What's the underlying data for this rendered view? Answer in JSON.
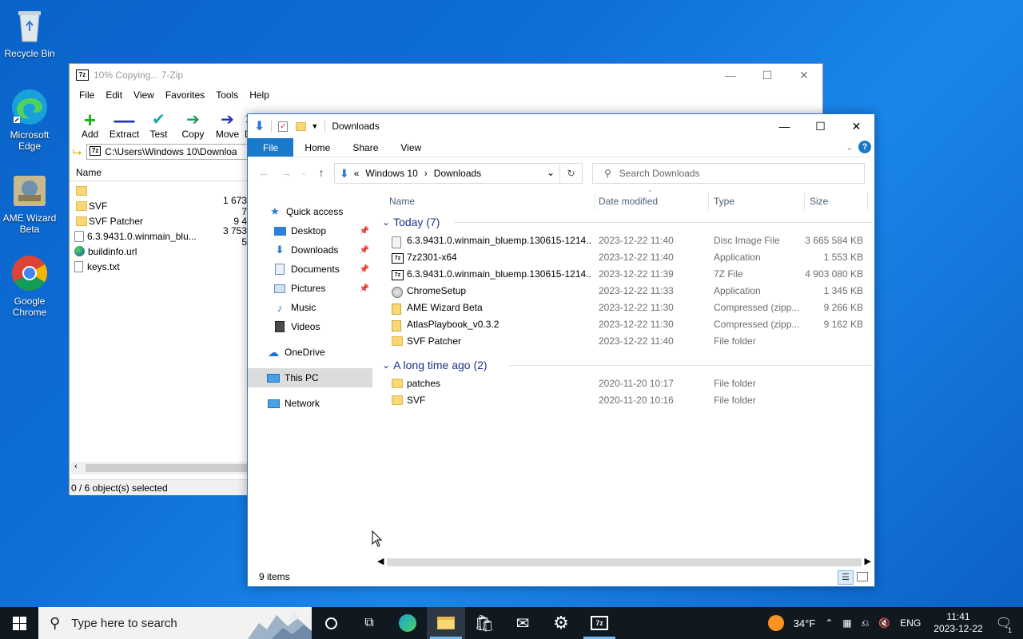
{
  "desktop": {
    "icons": [
      {
        "label": "Recycle Bin"
      },
      {
        "label": "Microsoft Edge"
      },
      {
        "label": "AME Wizard Beta"
      },
      {
        "label": "Google Chrome"
      }
    ]
  },
  "zip": {
    "title": "10% Copying... 7-Zip",
    "menu": [
      "File",
      "Edit",
      "View",
      "Favorites",
      "Tools",
      "Help"
    ],
    "tools": [
      "Add",
      "Extract",
      "Test",
      "Copy",
      "Move",
      "D"
    ],
    "path": "C:\\Users\\Windows 10\\Downloa",
    "col_name": "Name",
    "rows": [
      {
        "name": "",
        "size": ""
      },
      {
        "name": "SVF",
        "size": "1 673 7"
      },
      {
        "name": "SVF Patcher",
        "size": "9 4"
      },
      {
        "name": "6.3.9431.0.winmain_blu...",
        "size": "3 753 5"
      },
      {
        "name": "buildinfo.url",
        "size": ""
      },
      {
        "name": "keys.txt",
        "size": ""
      }
    ],
    "status": "0 / 6 object(s) selected"
  },
  "explorer": {
    "title": "Downloads",
    "ribbon_tabs": [
      "File",
      "Home",
      "Share",
      "View"
    ],
    "breadcrumb": {
      "prefix": "«",
      "parent": "Windows 10",
      "current": "Downloads"
    },
    "search_placeholder": "Search Downloads",
    "nav": {
      "quick_access": "Quick access",
      "desktop": "Desktop",
      "downloads": "Downloads",
      "documents": "Documents",
      "pictures": "Pictures",
      "music": "Music",
      "videos": "Videos",
      "onedrive": "OneDrive",
      "this_pc": "This PC",
      "network": "Network"
    },
    "columns": {
      "name": "Name",
      "date": "Date modified",
      "type": "Type",
      "size": "Size"
    },
    "groups": [
      {
        "label": "Today (7)",
        "files": [
          {
            "name": "6.3.9431.0.winmain_bluemp.130615-1214...",
            "date": "2023-12-22 11:40",
            "type": "Disc Image File",
            "size": "3 665 584 KB",
            "icon": "disc-image-icon"
          },
          {
            "name": "7z2301-x64",
            "date": "2023-12-22 11:40",
            "type": "Application",
            "size": "1 553 KB",
            "icon": "7zip-app-icon"
          },
          {
            "name": "6.3.9431.0.winmain_bluemp.130615-1214...",
            "date": "2023-12-22 11:39",
            "type": "7Z File",
            "size": "4 903 080 KB",
            "icon": "7z-file-icon"
          },
          {
            "name": "ChromeSetup",
            "date": "2023-12-22 11:33",
            "type": "Application",
            "size": "1 345 KB",
            "icon": "installer-icon"
          },
          {
            "name": "AME Wizard Beta",
            "date": "2023-12-22 11:30",
            "type": "Compressed (zipp...",
            "size": "9 266 KB",
            "icon": "zip-folder-icon"
          },
          {
            "name": "AtlasPlaybook_v0.3.2",
            "date": "2023-12-22 11:30",
            "type": "Compressed (zipp...",
            "size": "9 162 KB",
            "icon": "zip-folder-icon"
          },
          {
            "name": "SVF Patcher",
            "date": "2023-12-22 11:40",
            "type": "File folder",
            "size": "",
            "icon": "folder-icon"
          }
        ]
      },
      {
        "label": "A long time ago (2)",
        "files": [
          {
            "name": "patches",
            "date": "2020-11-20 10:17",
            "type": "File folder",
            "size": "",
            "icon": "folder-icon"
          },
          {
            "name": "SVF",
            "date": "2020-11-20 10:16",
            "type": "File folder",
            "size": "",
            "icon": "folder-icon"
          }
        ]
      }
    ],
    "status": "9 items"
  },
  "taskbar": {
    "search_placeholder": "Type here to search",
    "weather": "34°F",
    "language": "ENG",
    "time": "11:41",
    "date": "2023-12-22",
    "notifications": "1"
  }
}
